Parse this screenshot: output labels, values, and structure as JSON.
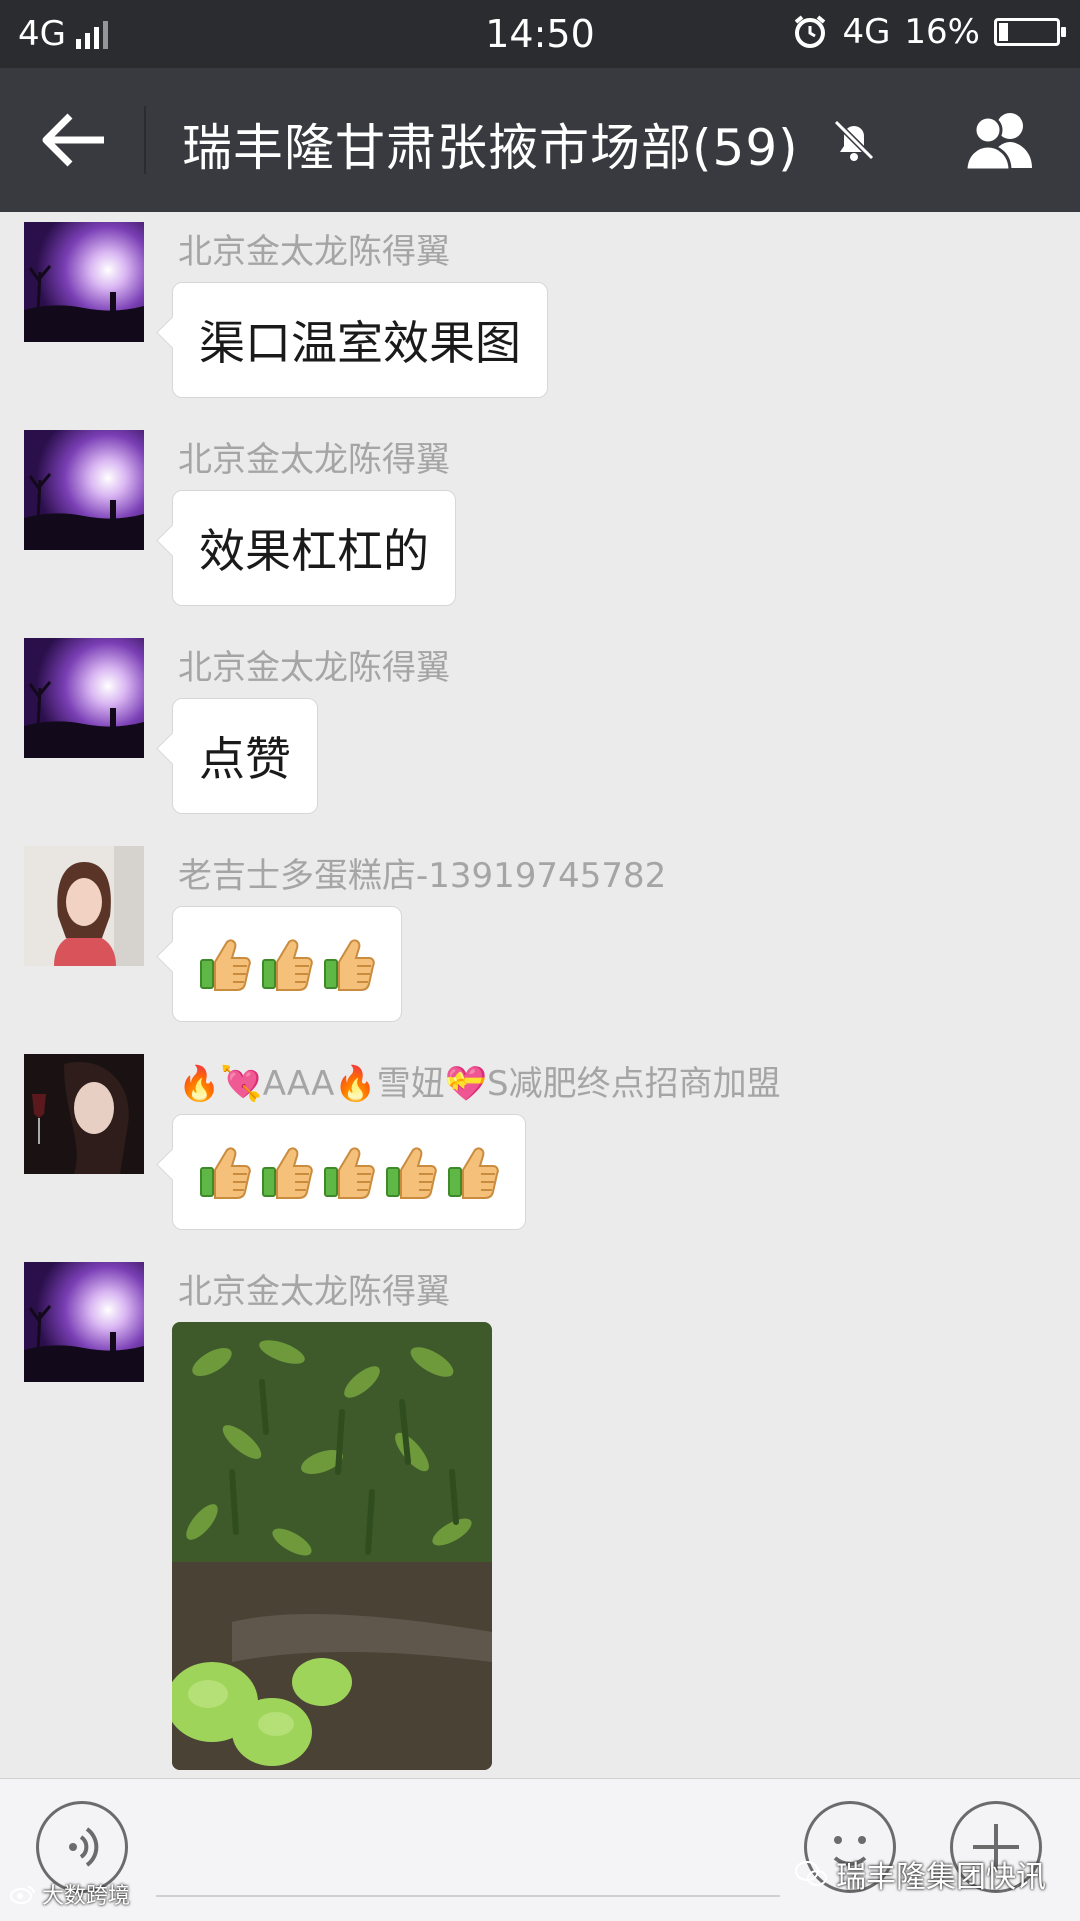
{
  "status_bar": {
    "network_left": "4G",
    "time": "14:50",
    "network_right": "4G",
    "battery": "16%",
    "battery_level": 0.16
  },
  "header": {
    "title": "瑞丰隆甘肃张掖市场部(59)",
    "back_icon": "back-arrow-icon",
    "mute_icon": "muted-bell-icon",
    "members_icon": "group-members-icon"
  },
  "messages": [
    {
      "sender": "北京金太龙陈得翼",
      "text": "渠口温室效果图",
      "avatar": "night-sky-avatar"
    },
    {
      "sender": "北京金太龙陈得翼",
      "text": "效果杠杠的",
      "avatar": "night-sky-avatar"
    },
    {
      "sender": "北京金太龙陈得翼",
      "text": "点赞",
      "avatar": "night-sky-avatar"
    },
    {
      "sender": "老吉士多蛋糕店-13919745782",
      "thumbs": 3,
      "avatar": "woman-portrait-avatar"
    },
    {
      "sender_parts": [
        "AAA",
        "雪妞",
        "S减肥终点招商加盟"
      ],
      "thumbs": 5,
      "avatar": "woman-profile-avatar"
    },
    {
      "sender": "北京金太龙陈得翼",
      "image": "pepper-greenhouse-photo",
      "avatar": "night-sky-avatar"
    }
  ],
  "input_bar": {
    "voice_icon": "voice-icon",
    "emoji_icon": "emoji-icon",
    "plus_icon": "plus-icon"
  },
  "watermarks": {
    "left": "大数跨境",
    "right": "瑞丰隆集团快讯"
  }
}
